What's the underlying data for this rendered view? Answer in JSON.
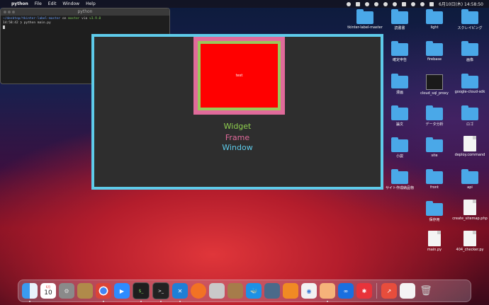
{
  "menubar": {
    "app": "python",
    "items": [
      "File",
      "Edit",
      "Window",
      "Help"
    ],
    "clock": "6月10日(木) 14:58:50"
  },
  "terminal": {
    "title": "python",
    "line1_path": "~/desktop/tkinter-label-master",
    "line1_on": "on",
    "line1_branch": "master",
    "line1_via": "via",
    "line1_ver": "v3.9.0",
    "line2": "14:58:42 ❯ python main.py"
  },
  "tkapp": {
    "label_text": "test",
    "legend": [
      "Widget",
      "Frame",
      "Window"
    ],
    "colors": {
      "window": "#5ecbea",
      "frame": "#e06a9a",
      "widget": "#9ac85a",
      "label_bg": "#ff0000"
    }
  },
  "desktop": {
    "items": [
      {
        "label": "tkinter-label-master",
        "icon": "folder-icon"
      },
      {
        "label": "読書書",
        "icon": "folder-icon"
      },
      {
        "label": "light",
        "icon": "folder-icon"
      },
      {
        "label": "スクレイピング",
        "icon": "folder-icon"
      },
      {
        "label": "確定申告",
        "icon": "folder-icon"
      },
      {
        "label": "firebase",
        "icon": "folder-icon"
      },
      {
        "label": "画像",
        "icon": "folder-icon"
      },
      {
        "label": "漫画",
        "icon": "folder-icon"
      },
      {
        "label": "cloud_sql_proxy",
        "icon": "terminal-file-icon"
      },
      {
        "label": "google-cloud-sdk",
        "icon": "folder-icon"
      },
      {
        "label": "論文",
        "icon": "folder-icon"
      },
      {
        "label": "データ分析",
        "icon": "folder-icon"
      },
      {
        "label": "ロゴ",
        "icon": "folder-icon"
      },
      {
        "label": "小説",
        "icon": "folder-icon"
      },
      {
        "label": "site",
        "icon": "folder-icon"
      },
      {
        "label": "deploy.command",
        "icon": "file-icon"
      },
      {
        "label": "サイト作成納品物",
        "icon": "folder-icon"
      },
      {
        "label": "front",
        "icon": "folder-icon"
      },
      {
        "label": "api",
        "icon": "folder-icon"
      },
      {
        "label": "保存用",
        "icon": "folder-icon"
      },
      {
        "label": "create_sitemap.php",
        "icon": "file-icon"
      },
      {
        "label": "main.py",
        "icon": "file-icon"
      },
      {
        "label": "404_checker.py",
        "icon": "file-icon"
      }
    ]
  },
  "dock": {
    "calendar_day": "10",
    "calendar_month": "6月"
  }
}
